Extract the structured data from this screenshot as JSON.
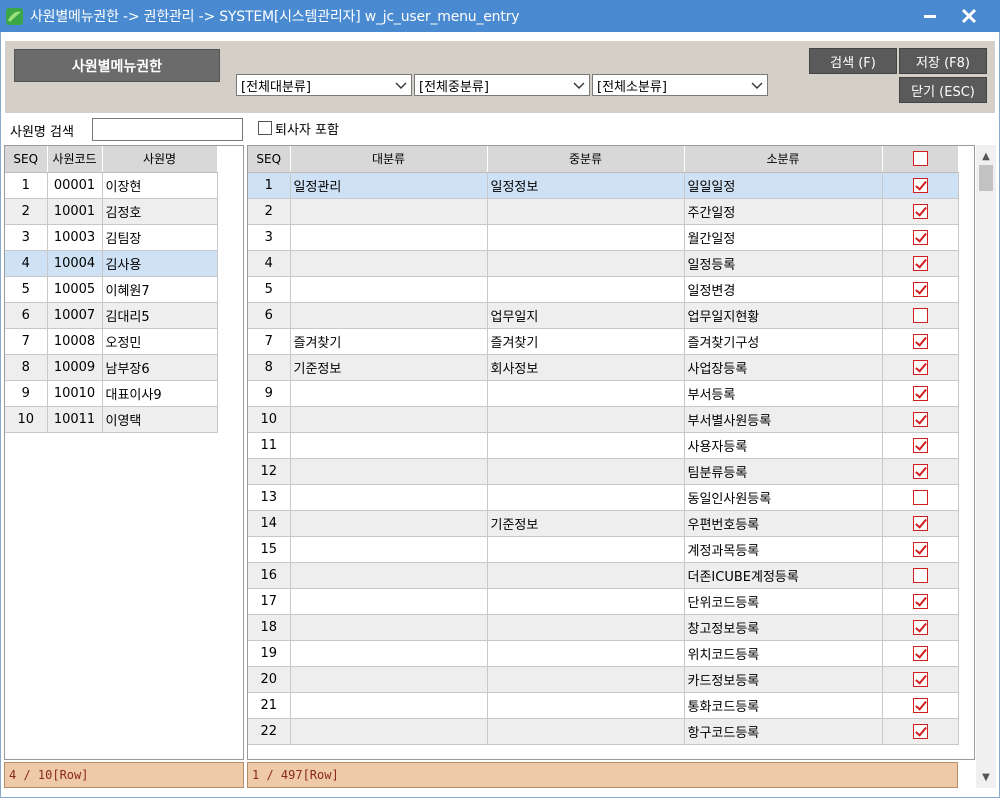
{
  "window": {
    "title": "사원별메뉴권한 -> 권한관리 -> SYSTEM[시스템관리자] w_jc_user_menu_entry"
  },
  "header": {
    "page_title": "사원별메뉴권한",
    "combos": [
      "[전체대분류]",
      "[전체중분류]",
      "[전체소분류]"
    ],
    "buttons": {
      "search": "검색 (F)",
      "save": "저장 (F8)",
      "close": "닫기 (ESC)"
    }
  },
  "filter": {
    "search_label": "사원명 검색",
    "search_value": "",
    "include_retired_label": "퇴사자 포함"
  },
  "employees": {
    "columns": [
      "SEQ",
      "사원코드",
      "사원명"
    ],
    "rows": [
      [
        "1",
        "00001",
        "이장현"
      ],
      [
        "2",
        "10001",
        "김정호"
      ],
      [
        "3",
        "10003",
        "김팀장"
      ],
      [
        "4",
        "10004",
        "김사용"
      ],
      [
        "5",
        "10005",
        "이혜원7"
      ],
      [
        "6",
        "10007",
        "김대리5"
      ],
      [
        "7",
        "10008",
        "오정민"
      ],
      [
        "8",
        "10009",
        "남부장6"
      ],
      [
        "9",
        "10010",
        "대표이사9"
      ],
      [
        "10",
        "10011",
        "이영택"
      ]
    ],
    "selected_index": 3,
    "footer": "4 / 10[Row]"
  },
  "menus": {
    "columns": [
      "SEQ",
      "대분류",
      "중분류",
      "소분류"
    ],
    "rows": [
      [
        "1",
        "일정관리",
        "일정정보",
        "일일일정",
        true
      ],
      [
        "2",
        "",
        "",
        "주간일정",
        true
      ],
      [
        "3",
        "",
        "",
        "월간일정",
        true
      ],
      [
        "4",
        "",
        "",
        "일정등록",
        true
      ],
      [
        "5",
        "",
        "",
        "일정변경",
        true
      ],
      [
        "6",
        "",
        "업무일지",
        "업무일지현황",
        false
      ],
      [
        "7",
        "즐겨찾기",
        "즐겨찾기",
        "즐겨찾기구성",
        true
      ],
      [
        "8",
        "기준정보",
        "회사정보",
        "사업장등록",
        true
      ],
      [
        "9",
        "",
        "",
        "부서등록",
        true
      ],
      [
        "10",
        "",
        "",
        "부서별사원등록",
        true
      ],
      [
        "11",
        "",
        "",
        "사용자등록",
        true
      ],
      [
        "12",
        "",
        "",
        "팀분류등록",
        true
      ],
      [
        "13",
        "",
        "",
        "동일인사원등록",
        false
      ],
      [
        "14",
        "",
        "기준정보",
        "우편번호등록",
        true
      ],
      [
        "15",
        "",
        "",
        "계정과목등록",
        true
      ],
      [
        "16",
        "",
        "",
        "더존ICUBE계정등록",
        false
      ],
      [
        "17",
        "",
        "",
        "단위코드등록",
        true
      ],
      [
        "18",
        "",
        "",
        "창고정보등록",
        true
      ],
      [
        "19",
        "",
        "",
        "위치코드등록",
        true
      ],
      [
        "20",
        "",
        "",
        "카드정보등록",
        true
      ],
      [
        "21",
        "",
        "",
        "통화코드등록",
        true
      ],
      [
        "22",
        "",
        "",
        "항구코드등록",
        true
      ]
    ],
    "selected_index": 0,
    "footer": "1 / 497[Row]"
  }
}
